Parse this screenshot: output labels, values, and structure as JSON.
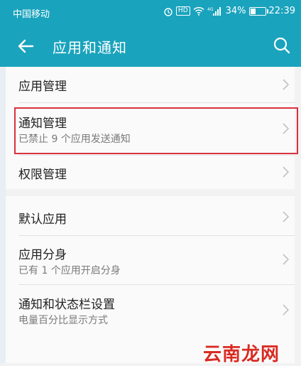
{
  "status_bar": {
    "carrier": "中国移动",
    "network": "4G",
    "battery_percent": "34%",
    "battery_level": 0.34,
    "time": "22:39",
    "hd_label": "HD"
  },
  "app_bar": {
    "title": "应用和通知"
  },
  "settings": {
    "items": [
      {
        "label": "应用管理"
      },
      {
        "label": "通知管理",
        "sub": "已禁止 9 个应用发送通知"
      },
      {
        "label": "权限管理"
      },
      {
        "label": "默认应用"
      },
      {
        "label": "应用分身",
        "sub": "已有 1 个应用开启分身"
      },
      {
        "label": "通知和状态栏设置",
        "sub": "电量百分比显示方式"
      }
    ]
  },
  "watermark": "云南龙网",
  "colors": {
    "accent": "#1aa3bd",
    "highlight_border": "#d9313f",
    "watermark": "#d92b22"
  }
}
